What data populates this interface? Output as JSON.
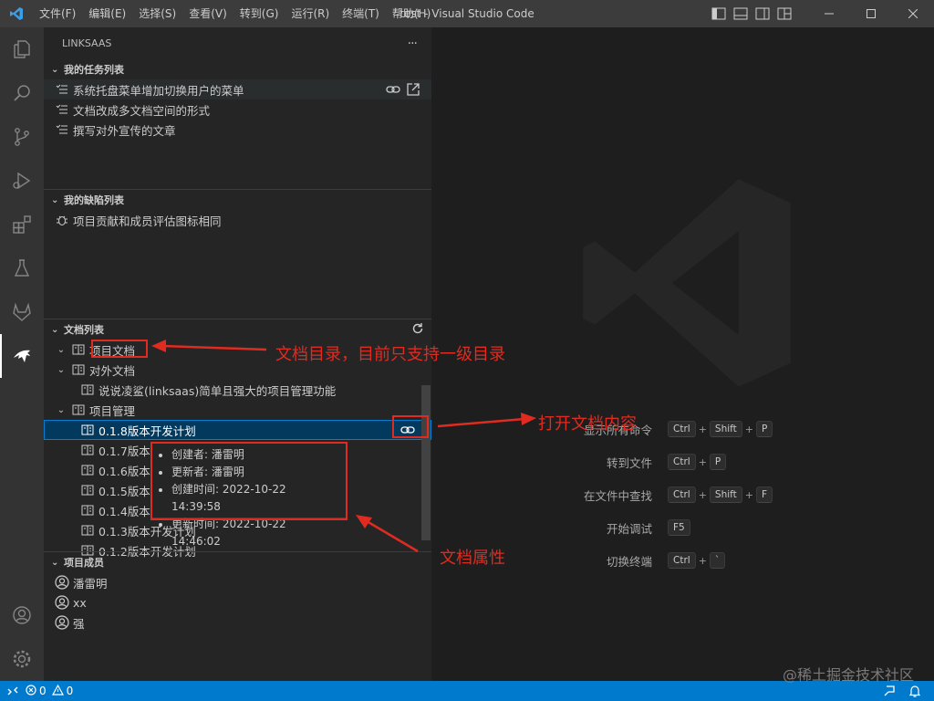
{
  "app": {
    "window_title": "test - Visual Studio Code",
    "accent_color": "#007acc",
    "annotation_color": "#e02b20"
  },
  "menu": [
    "文件(F)",
    "编辑(E)",
    "选择(S)",
    "查看(V)",
    "转到(G)",
    "运行(R)",
    "终端(T)",
    "帮助(H)"
  ],
  "sidebar": {
    "title": "LINKSAAS",
    "more_label": "···",
    "tasks": {
      "header": "我的任务列表",
      "items": [
        "系统托盘菜单增加切换用户的菜单",
        "文档改成多文档空间的形式",
        "撰写对外宣传的文章"
      ]
    },
    "bugs": {
      "header": "我的缺陷列表",
      "items": [
        "项目贡献和成员评估图标相同"
      ]
    },
    "docs": {
      "header": "文档列表",
      "folders": [
        "项目文档",
        "对外文档",
        "项目管理"
      ],
      "external_doc": "说说凌鲨(linksaas)简单且强大的项目管理功能",
      "selected_doc": "0.1.8版本开发计划",
      "version_docs": [
        "0.1.7版本",
        "0.1.6版本",
        "0.1.5版本",
        "0.1.4版本",
        "0.1.3版本开发计划",
        "0.1.2版本开发计划"
      ]
    },
    "members": {
      "header": "项目成员",
      "items": [
        "潘雷明",
        "xx",
        "强"
      ]
    }
  },
  "tooltip": {
    "lines": [
      "创建者: 潘雷明",
      "更新者: 潘雷明",
      "创建时间: 2022-10-22 14:39:58",
      "更新时间: 2022-10-22 14:46:02"
    ]
  },
  "editor": {
    "shortcuts": [
      {
        "label": "显示所有命令",
        "keys": [
          "Ctrl",
          "Shift",
          "P"
        ]
      },
      {
        "label": "转到文件",
        "keys": [
          "Ctrl",
          "P"
        ]
      },
      {
        "label": "在文件中查找",
        "keys": [
          "Ctrl",
          "Shift",
          "F"
        ]
      },
      {
        "label": "开始调试",
        "keys": [
          "F5"
        ]
      },
      {
        "label": "切换终端",
        "keys": [
          "Ctrl",
          "`"
        ]
      }
    ]
  },
  "annotations": {
    "doc_dir": "文档目录，目前只支持一级目录",
    "open_doc": "打开文档内容",
    "doc_props": "文档属性"
  },
  "statusbar": {
    "errors": "0",
    "warnings": "0"
  },
  "watermark": "@稀土掘金技术社区"
}
